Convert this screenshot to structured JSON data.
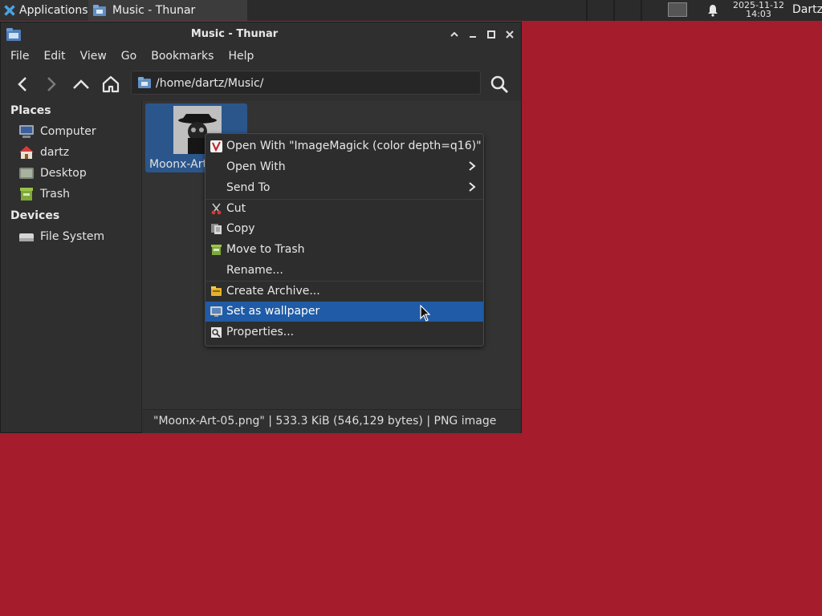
{
  "panel": {
    "apps_label": "Applications",
    "apps_suffix": "☰",
    "task_label": "Music - Thunar",
    "clock_date": "2025-11-12",
    "clock_time": "14:03",
    "user": "Dartz"
  },
  "window": {
    "title": "Music - Thunar",
    "menu": [
      "File",
      "Edit",
      "View",
      "Go",
      "Bookmarks",
      "Help"
    ],
    "location": "/home/dartz/Music/"
  },
  "sidebar": {
    "places_heading": "Places",
    "places": [
      {
        "label": "Computer",
        "icon": "computer-icon"
      },
      {
        "label": "dartz",
        "icon": "home-folder-icon"
      },
      {
        "label": "Desktop",
        "icon": "desktop-icon"
      },
      {
        "label": "Trash",
        "icon": "trash-icon"
      }
    ],
    "devices_heading": "Devices",
    "devices": [
      {
        "label": "File System",
        "icon": "drive-icon"
      }
    ]
  },
  "content": {
    "file_name": "Moonx-Art-05.png",
    "file_name_visible": "Moonx-Art"
  },
  "status": "\"Moonx-Art-05.png\"  |  533.3 KiB (546,129 bytes)  |  PNG image",
  "context_menu": {
    "items": [
      {
        "label": "Open With \"ImageMagick (color depth=q16)\"",
        "icon": "imagemagick-icon"
      },
      {
        "label": "Open With",
        "submenu": true
      },
      {
        "label": "Send To",
        "submenu": true
      },
      {
        "label": "Cut",
        "icon": "scissors-icon"
      },
      {
        "label": "Copy",
        "icon": "copy-icon"
      },
      {
        "label": "Move to Trash",
        "icon": "trash-icon"
      },
      {
        "label": "Rename...",
        "icon": ""
      },
      {
        "label": "Create Archive...",
        "icon": "archive-icon"
      },
      {
        "label": "Set as wallpaper",
        "icon": "wallpaper-icon",
        "highlighted": true
      },
      {
        "label": "Properties...",
        "icon": "properties-icon"
      }
    ]
  },
  "colors": {
    "desktop": "#a51c2c",
    "highlight": "#1f5ba6",
    "window_bg": "#2f2f2f"
  }
}
